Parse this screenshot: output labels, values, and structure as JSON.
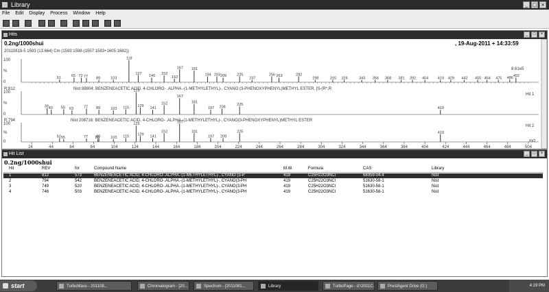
{
  "app": {
    "title": "Library"
  },
  "menu": [
    "File",
    "Edit",
    "Display",
    "Process",
    "Window",
    "Help"
  ],
  "hits_panel": {
    "title": "Hits",
    "sample": "0.2ng/1000shui",
    "date": ", 19-Aug-2011 + 14:33:59",
    "scan_info": "20110819-5 1593 (13.664) Cm (1593:1598-(1557:1583+1605:1682))",
    "y_max_label": "100",
    "y_unit": "%",
    "y_min_label": "0",
    "top_intensity": "8.61e5",
    "sample_peaks": [
      {
        "mz": 51,
        "h": 0.12,
        "label": "51"
      },
      {
        "mz": 65,
        "h": 0.2,
        "label": "65"
      },
      {
        "mz": 72,
        "h": 0.2,
        "label": "72"
      },
      {
        "mz": 77,
        "h": 0.18,
        "label": "77"
      },
      {
        "mz": 89,
        "h": 0.1,
        "label": "89"
      },
      {
        "mz": 103,
        "h": 0.1,
        "label": "103"
      },
      {
        "mz": 118,
        "h": 0.95,
        "label": "118"
      },
      {
        "mz": 127,
        "h": 0.3,
        "label": "127"
      },
      {
        "mz": 140,
        "h": 0.2,
        "label": "140"
      },
      {
        "mz": 152,
        "h": 0.3,
        "label": "152"
      },
      {
        "mz": 162,
        "h": 0.15,
        "label": "162"
      },
      {
        "mz": 167,
        "h": 0.55,
        "label": "167"
      },
      {
        "mz": 181,
        "h": 0.5,
        "label": "181"
      },
      {
        "mz": 194,
        "h": 0.25,
        "label": "194"
      },
      {
        "mz": 203,
        "h": 0.25,
        "label": "203"
      },
      {
        "mz": 209,
        "h": 0.2,
        "label": "209"
      },
      {
        "mz": 225,
        "h": 0.25,
        "label": "225"
      },
      {
        "mz": 237,
        "h": 0.1,
        "label": "237"
      },
      {
        "mz": 256,
        "h": 0.25,
        "label": "256"
      },
      {
        "mz": 263,
        "h": 0.2,
        "label": "263"
      },
      {
        "mz": 282,
        "h": 0.25,
        "label": "282"
      },
      {
        "mz": 298,
        "h": 0.1,
        "label": "298"
      },
      {
        "mz": 315,
        "h": 0.1,
        "label": "315"
      },
      {
        "mz": 326,
        "h": 0.1,
        "label": "326"
      },
      {
        "mz": 343,
        "h": 0.1,
        "label": "343"
      },
      {
        "mz": 356,
        "h": 0.1,
        "label": "356"
      },
      {
        "mz": 368,
        "h": 0.1,
        "label": "368"
      },
      {
        "mz": 381,
        "h": 0.1,
        "label": "381"
      },
      {
        "mz": 392,
        "h": 0.1,
        "label": "392"
      },
      {
        "mz": 404,
        "h": 0.1,
        "label": "404"
      },
      {
        "mz": 419,
        "h": 0.1,
        "label": "419"
      },
      {
        "mz": 429,
        "h": 0.1,
        "label": "429"
      },
      {
        "mz": 442,
        "h": 0.1,
        "label": "442"
      },
      {
        "mz": 455,
        "h": 0.1,
        "label": "455"
      },
      {
        "mz": 464,
        "h": 0.1,
        "label": "464"
      },
      {
        "mz": 475,
        "h": 0.1,
        "label": "475"
      },
      {
        "mz": 486,
        "h": 0.12,
        "label": "486"
      },
      {
        "mz": 492,
        "h": 0.2,
        "label": "492"
      }
    ],
    "hit1": {
      "header_prefix": "R:812",
      "header": "Nist 88804: BENZENEACETIC ACID, 4-CHLORO- .ALPHA.-(1-METHYLETHYL)-, CYANO (3-PHENOXYPHENYL)METHYL ESTER, [S-(R*,R",
      "tag": "Hit 1",
      "peaks": [
        {
          "mz": 39,
          "h": 0.28,
          "label": "39"
        },
        {
          "mz": 43,
          "h": 0.2,
          "label": "43"
        },
        {
          "mz": 55,
          "h": 0.22,
          "label": "55"
        },
        {
          "mz": 63,
          "h": 0.18,
          "label": "63"
        },
        {
          "mz": 77,
          "h": 0.25,
          "label": "77"
        },
        {
          "mz": 89,
          "h": 0.2,
          "label": "89"
        },
        {
          "mz": 103,
          "h": 0.18,
          "label": "103"
        },
        {
          "mz": 115,
          "h": 0.22,
          "label": "115"
        },
        {
          "mz": 125,
          "h": 0.95,
          "label": "125"
        },
        {
          "mz": 129,
          "h": 0.3,
          "label": "129"
        },
        {
          "mz": 141,
          "h": 0.2,
          "label": "141"
        },
        {
          "mz": 152,
          "h": 0.4,
          "label": "152"
        },
        {
          "mz": 167,
          "h": 0.7,
          "label": "167"
        },
        {
          "mz": 181,
          "h": 0.45,
          "label": "181"
        },
        {
          "mz": 197,
          "h": 0.2,
          "label": "197"
        },
        {
          "mz": 208,
          "h": 0.25,
          "label": "208"
        },
        {
          "mz": 225,
          "h": 0.35,
          "label": "225"
        },
        {
          "mz": 419,
          "h": 0.2,
          "label": "419"
        }
      ]
    },
    "hit2": {
      "header_prefix": "R:794",
      "header": "Nist 208716: BENZENEACETIC ACID, 4-CHLORO- .ALPHA.-(1-METHYLETHYL)-, CYANO(3-PHENOXYPHENYL)METHYL ESTER",
      "tag": "Hit 2",
      "peaks": [
        {
          "mz": 51,
          "h": 0.2,
          "label": "51"
        },
        {
          "mz": 55,
          "h": 0.15,
          "label": "55"
        },
        {
          "mz": 77,
          "h": 0.18,
          "label": "77"
        },
        {
          "mz": 88,
          "h": 0.15,
          "label": "88"
        },
        {
          "mz": 89,
          "h": 0.2,
          "label": "89"
        },
        {
          "mz": 103,
          "h": 0.15,
          "label": "103"
        },
        {
          "mz": 115,
          "h": 0.2,
          "label": "115"
        },
        {
          "mz": 125,
          "h": 0.85,
          "label": "125"
        },
        {
          "mz": 129,
          "h": 0.3,
          "label": "129"
        },
        {
          "mz": 141,
          "h": 0.2,
          "label": "141"
        },
        {
          "mz": 152,
          "h": 0.45,
          "label": "152"
        },
        {
          "mz": 167,
          "h": 0.95,
          "label": "167"
        },
        {
          "mz": 181,
          "h": 0.45,
          "label": "181"
        },
        {
          "mz": 197,
          "h": 0.2,
          "label": "197"
        },
        {
          "mz": 209,
          "h": 0.2,
          "label": "209"
        },
        {
          "mz": 225,
          "h": 0.45,
          "label": "225"
        },
        {
          "mz": 419,
          "h": 0.4,
          "label": "419"
        }
      ]
    },
    "x_ticks": [
      24,
      44,
      64,
      84,
      104,
      124,
      144,
      164,
      184,
      204,
      224,
      244,
      264,
      284,
      304,
      324,
      344,
      364,
      384,
      404,
      424,
      444,
      464,
      484,
      504
    ],
    "x_unit": "m/z"
  },
  "hitlist_panel": {
    "title": "Hit List",
    "sample": "0.2ng/1000shui",
    "columns": [
      "Hit",
      "REV",
      "for",
      "Compound Name",
      "M.W.",
      "Formula",
      "CAS",
      "Library"
    ],
    "rows": [
      [
        "1",
        "812",
        "573",
        "BENZENEACETIC ACID, 4-CHLORO-.ALPHA.-(1-METHYLETHYL)-, CYANO (3-P",
        "419",
        "C25H22O3NCl",
        "68359-04-4",
        "Nist"
      ],
      [
        "2",
        "794",
        "542",
        "BENZENEACETIC ACID, 4-CHLORO-.ALPHA.-(1-METHYLETHYL)-, CYANO(3-PH",
        "419",
        "C25H22O3NCl",
        "51630-58-1",
        "Nist"
      ],
      [
        "3",
        "749",
        "520",
        "BENZENEACETIC ACID, 4-CHLORO-.ALPHA.-(1-METHYLETHYL)-, CYANO(3-PH",
        "419",
        "C25H22O3NCl",
        "51630-58-1",
        "Nist"
      ],
      [
        "4",
        "746",
        "503",
        "BENZENEACETIC ACID, 4-CHLORO-.ALPHA.-(1-METHYLETHYL)-, CYANO(3-PH",
        "419",
        "C25H22O3NCl",
        "51630-58-1",
        "Nist"
      ]
    ]
  },
  "taskbar": {
    "start": "start",
    "items": [
      "TurboMass - 201108...",
      "Chromatogram - [20...",
      "Spectrum - [2011081...",
      "Library",
      "TurboPage - d:\\2011C...",
      "PrestAgent Drive (G:)"
    ],
    "clock": "4:19 PM"
  },
  "colors": {
    "title_bar": "#2a2a2a",
    "selected_row": "#2e2e2e",
    "peak": "#333333"
  }
}
